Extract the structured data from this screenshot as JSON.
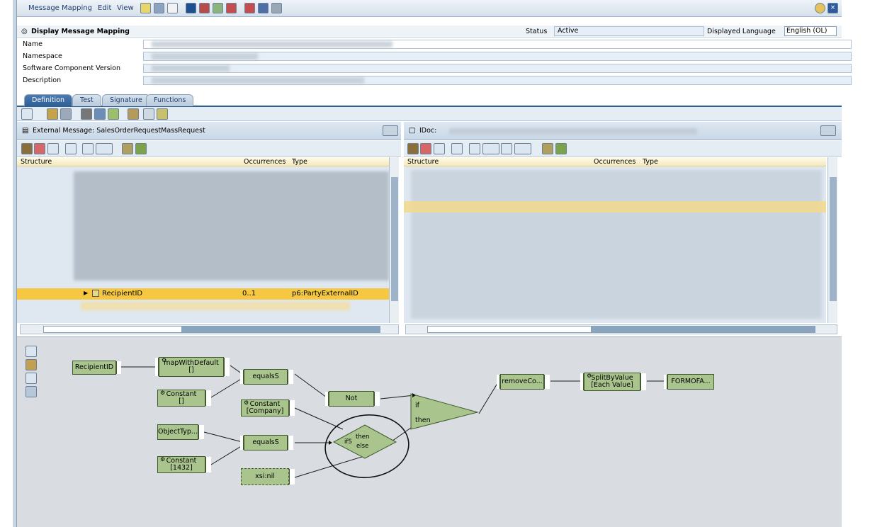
{
  "menu": {
    "message_mapping": "Message Mapping",
    "edit": "Edit",
    "view": "View"
  },
  "header": {
    "title": "Display Message Mapping",
    "status_label": "Status",
    "status_value": "Active",
    "language_label": "Displayed Language",
    "language_value": "English (OL)",
    "fields": [
      {
        "label": "Name"
      },
      {
        "label": "Namespace"
      },
      {
        "label": "Software Component Version"
      },
      {
        "label": "Description"
      }
    ]
  },
  "tabs": [
    "Definition",
    "Test",
    "Signature",
    "Functions"
  ],
  "left_pane": {
    "title": "External Message: SalesOrderRequestMassRequest",
    "columns": [
      "Structure",
      "Occurrences",
      "Type"
    ],
    "selected_row": {
      "name": "RecipientID",
      "occurrences": "0..1",
      "type": "p6:PartyExternalID"
    }
  },
  "right_pane": {
    "title": "IDoc: ",
    "columns": [
      "Structure",
      "Occurrences",
      "Type"
    ]
  },
  "graph": {
    "nodes": {
      "recipient": "RecipientID",
      "map_with_default": "mapWithDefault",
      "map_with_default_sub": "[]",
      "constant1": "Constant",
      "constant1_sub": "[]",
      "equals1": "equalsS",
      "constant_company": "Constant",
      "constant_company_sub": "[Company]",
      "not": "Not",
      "objecttyp": "ObjectTyp...",
      "equals2": "equalsS",
      "constant1432": "Constant",
      "constant1432_sub": "[1432]",
      "xsinil": "xsi:nil",
      "ifs": "ifS",
      "ifs_then": "then",
      "ifs_else": "else",
      "if_label": "if",
      "then_label": "then",
      "removeco": "removeCo...",
      "splitbyvalue": "SplitByValue",
      "splitbyvalue_sub": "[Each Value]",
      "formofa": "FORMOFA..."
    }
  }
}
